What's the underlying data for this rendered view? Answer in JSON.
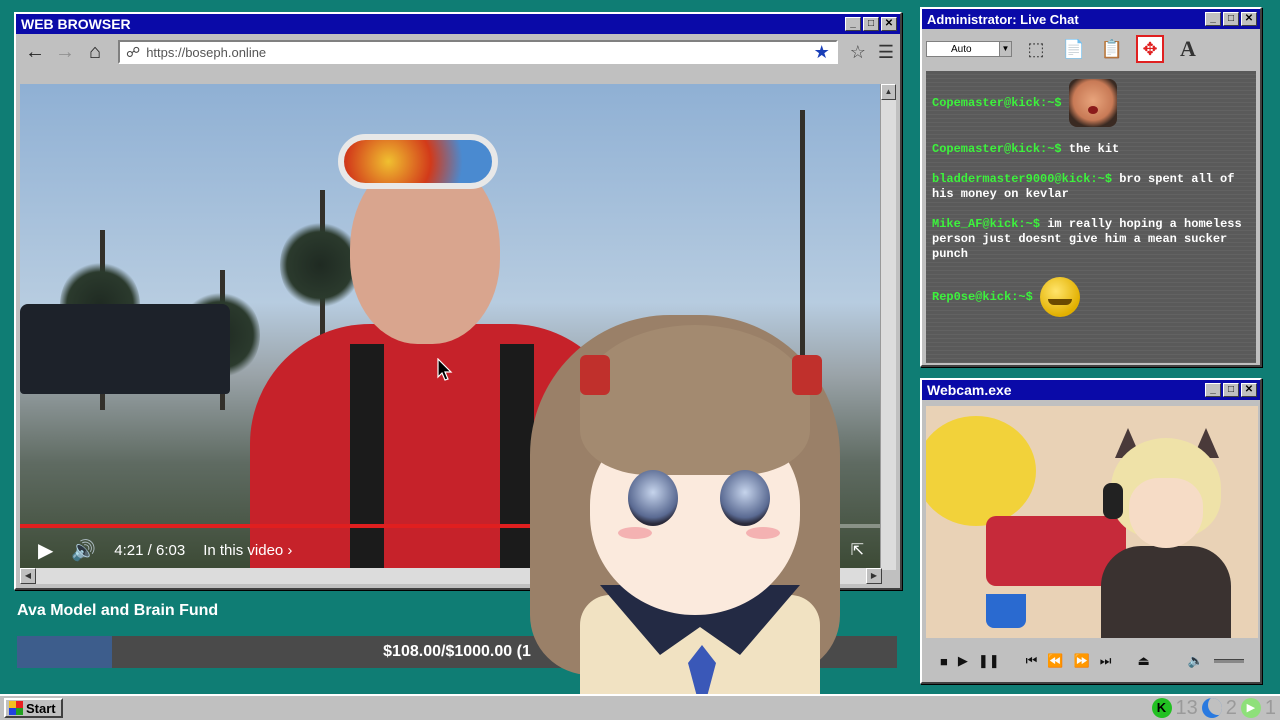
{
  "browser": {
    "title": "WEB BROWSER",
    "url": "https://boseph.online",
    "video": {
      "time": "4:21 / 6:03",
      "progress": 0.72,
      "in_this_video": "In this video"
    }
  },
  "fund": {
    "title": "Ava Model and Brain Fund",
    "amount_text": "$108.00/$1000.00 (1",
    "progress": 0.108
  },
  "chat": {
    "title": "Administrator: Live Chat",
    "font_select": "Auto",
    "messages": [
      {
        "user": "Copemaster@kick:~$",
        "text": "",
        "emote": "face-emote"
      },
      {
        "user": "Copemaster@kick:~$",
        "text": "the kit"
      },
      {
        "user": "bladdermaster9000@kick:~$",
        "text": "bro spent all of his money on kevlar"
      },
      {
        "user": "Mike_AF@kick:~$",
        "text": "im really hoping a homeless person just doesnt give him a mean sucker punch"
      },
      {
        "user": "Rep0se@kick:~$",
        "text": "",
        "emote": "smiley-emote"
      }
    ]
  },
  "webcam": {
    "title": "Webcam.exe"
  },
  "taskbar": {
    "start_label": "Start",
    "tray": {
      "kick_count": "13",
      "moon_count": "2",
      "play_count": "1"
    }
  },
  "colors": {
    "titlebar": "#0a0aa8",
    "desktop": "#0f7d74",
    "chat_username": "#3cf23c",
    "video_progress": "#e01f1f",
    "fund_fill": "#3d5d8c"
  }
}
